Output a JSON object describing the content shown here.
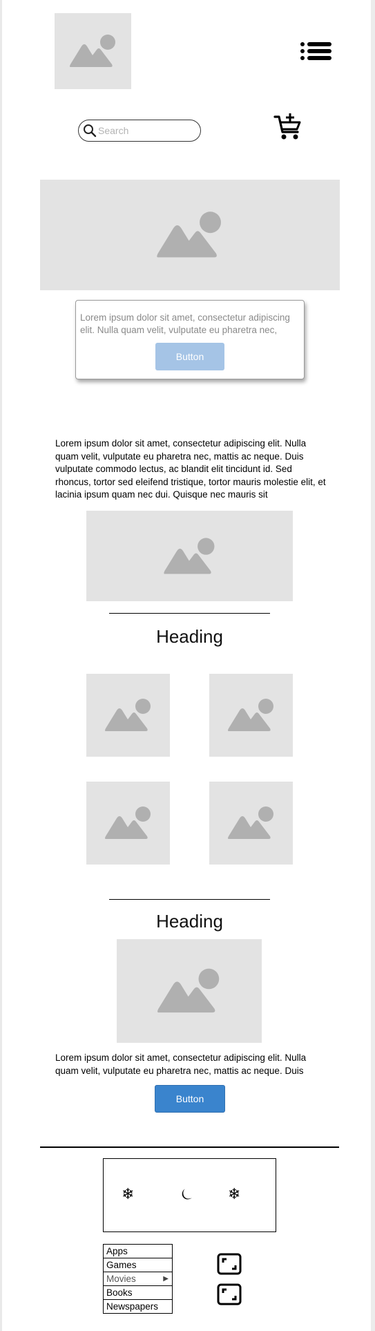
{
  "header": {
    "logo": "image-placeholder-icon",
    "menu_icon": "hamburger-menu-icon",
    "search": {
      "placeholder": "Search",
      "value": ""
    },
    "cart_icon": "add-to-cart-icon"
  },
  "hero": {
    "image": "image-placeholder-icon"
  },
  "card": {
    "text": "Lorem ipsum dolor sit amet, consectetur adipiscing elit. Nulla quam velit, vulputate eu pharetra nec,",
    "button_label": "Button"
  },
  "intro": {
    "paragraph": "Lorem ipsum dolor sit amet, consectetur adipiscing elit. Nulla quam velit, vulputate eu pharetra nec, mattis ac neque. Duis vulputate commodo lectus, ac blandit elit tincidunt id. Sed rhoncus, tortor sed eleifend tristique, tortor mauris molestie elit, et lacinia ipsum quam nec dui. Quisque nec mauris sit"
  },
  "section1": {
    "heading": "Heading"
  },
  "section2": {
    "heading": "Heading",
    "paragraph": "Lorem ipsum dolor sit amet, consectetur adipiscing elit. Nulla quam velit, vulputate eu pharetra nec, mattis ac neque. Duis",
    "button_label": "Button"
  },
  "icon_box": {
    "icons": [
      "snowflake-icon",
      "moon-icon",
      "snowflake-icon"
    ],
    "glyphs": [
      "❄",
      "⏾",
      "❄"
    ]
  },
  "menu": {
    "items": [
      {
        "label": "Apps"
      },
      {
        "label": "Games"
      },
      {
        "label": "Movies",
        "has_submenu": true,
        "arrow": "▶"
      },
      {
        "label": "Books"
      },
      {
        "label": "Newspapers"
      }
    ],
    "selected": "Movies"
  },
  "colors": {
    "placeholder_bg": "#e3e3e3",
    "placeholder_glyph": "#b0b0b0",
    "card_button": "#a5c4e6",
    "primary_button": "#3a84cd"
  }
}
